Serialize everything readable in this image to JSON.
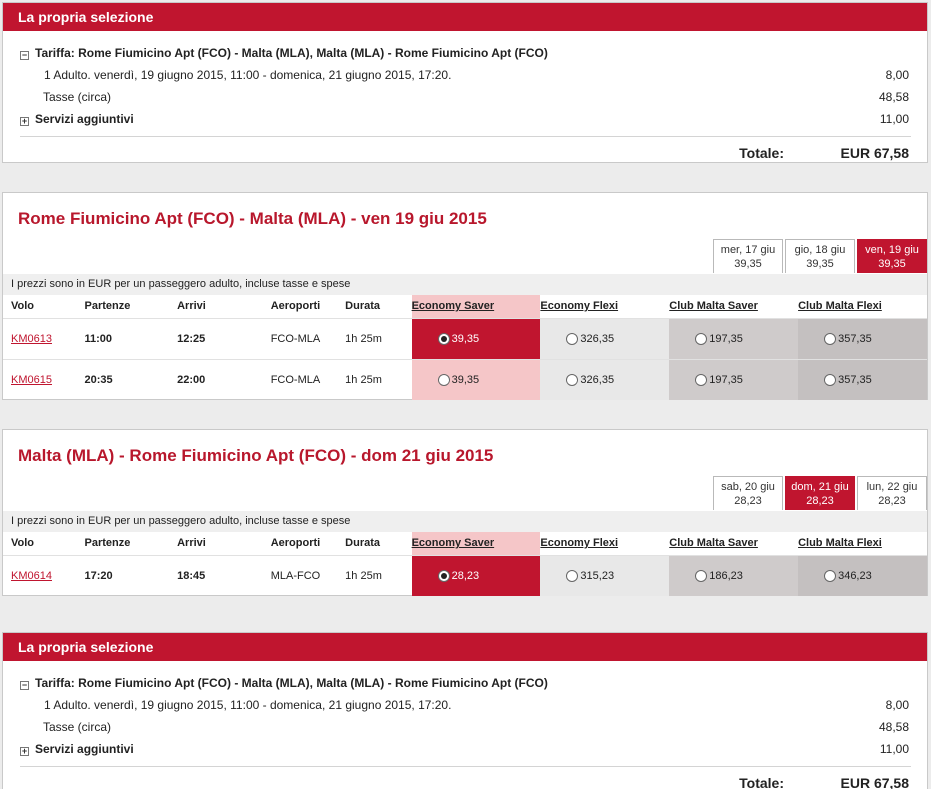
{
  "top_selection": {
    "title": "La propria selezione",
    "fare_label": "Tariffa: Rome Fiumicino Apt (FCO) - Malta (MLA), Malta (MLA) - Rome Fiumicino Apt (FCO)",
    "passenger_line": "1 Adulto. venerdì, 19 giugno 2015, 11:00 - domenica, 21 giugno 2015, 17:20.",
    "passenger_amount": "8,00",
    "tax_label": "Tasse (circa)",
    "tax_amount": "48,58",
    "extras_label": "Servizi aggiuntivi",
    "extras_amount": "11,00",
    "total_label": "Totale:",
    "total_value": "EUR 67,58",
    "expand_glyph": "−",
    "collapse_glyph": "+"
  },
  "outbound": {
    "title": "Rome Fiumicino Apt (FCO) - Malta (MLA) - ven 19 giu 2015",
    "dates": [
      {
        "day": "mer, 17 giu",
        "price": "39,35"
      },
      {
        "day": "gio, 18 giu",
        "price": "39,35"
      },
      {
        "day": "ven, 19 giu",
        "price": "39,35"
      }
    ],
    "note": "I prezzi sono in EUR per un passeggero adulto, incluse tasse e spese",
    "columns": [
      "Volo",
      "Partenze",
      "Arrivi",
      "Aeroporti",
      "Durata",
      "Economy Saver",
      "Economy Flexi",
      "Club Malta Saver",
      "Club Malta Flexi"
    ],
    "rows": [
      {
        "flight": "KM0613",
        "dep": "11:00",
        "arr": "12:25",
        "airports": "FCO-MLA",
        "dur": "1h 25m",
        "saver": "39,35",
        "flexi": "326,35",
        "club_saver": "197,35",
        "club_flexi": "357,35"
      },
      {
        "flight": "KM0615",
        "dep": "20:35",
        "arr": "22:00",
        "airports": "FCO-MLA",
        "dur": "1h 25m",
        "saver": "39,35",
        "flexi": "326,35",
        "club_saver": "197,35",
        "club_flexi": "357,35"
      }
    ]
  },
  "inbound": {
    "title": "Malta (MLA) - Rome Fiumicino Apt (FCO) - dom 21 giu 2015",
    "dates": [
      {
        "day": "sab, 20 giu",
        "price": "28,23"
      },
      {
        "day": "dom, 21 giu",
        "price": "28,23"
      },
      {
        "day": "lun, 22 giu",
        "price": "28,23"
      }
    ],
    "note": "I prezzi sono in EUR per un passeggero adulto, incluse tasse e spese",
    "columns": [
      "Volo",
      "Partenze",
      "Arrivi",
      "Aeroporti",
      "Durata",
      "Economy Saver",
      "Economy Flexi",
      "Club Malta Saver",
      "Club Malta Flexi"
    ],
    "rows": [
      {
        "flight": "KM0614",
        "dep": "17:20",
        "arr": "18:45",
        "airports": "MLA-FCO",
        "dur": "1h 25m",
        "saver": "28,23",
        "flexi": "315,23",
        "club_saver": "186,23",
        "club_flexi": "346,23"
      }
    ]
  },
  "bottom_selection": {
    "title": "La propria selezione",
    "fare_label": "Tariffa: Rome Fiumicino Apt (FCO) - Malta (MLA), Malta (MLA) - Rome Fiumicino Apt (FCO)",
    "passenger_line": "1 Adulto. venerdì, 19 giugno 2015, 11:00 - domenica, 21 giugno 2015, 17:20.",
    "passenger_amount": "8,00",
    "tax_label": "Tasse (circa)",
    "tax_amount": "48,58",
    "extras_label": "Servizi aggiuntivi",
    "extras_amount": "11,00",
    "total_label": "Totale:",
    "total_value": "EUR 67,58"
  },
  "colors": {
    "brand": "#c0152f",
    "title_red": "#b8172c"
  }
}
